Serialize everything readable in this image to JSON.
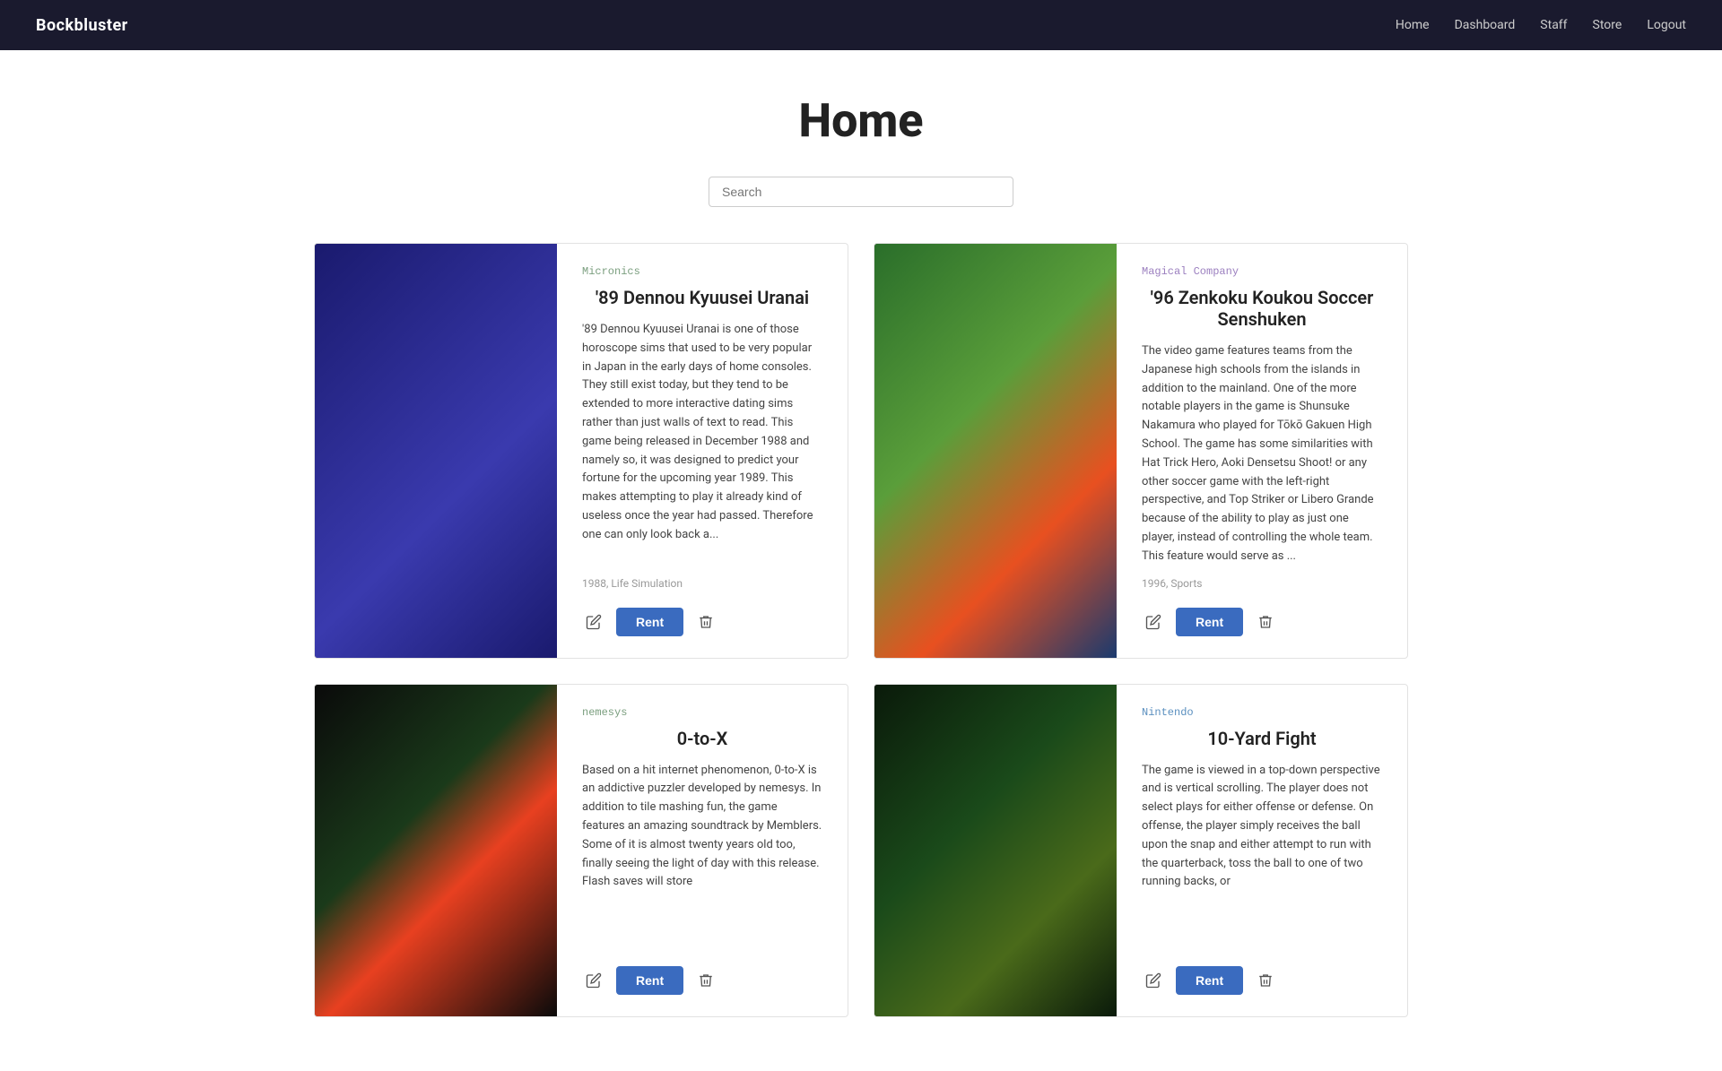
{
  "brand": "Bockbluster",
  "nav": {
    "links": [
      {
        "label": "Home",
        "id": "home"
      },
      {
        "label": "Dashboard",
        "id": "dashboard"
      },
      {
        "label": "Staff",
        "id": "staff"
      },
      {
        "label": "Store",
        "id": "store"
      },
      {
        "label": "Logout",
        "id": "logout"
      }
    ]
  },
  "page": {
    "title": "Home"
  },
  "search": {
    "placeholder": "Search"
  },
  "cards": [
    {
      "id": "card-89dennou",
      "publisher": "Micronics",
      "publisher_color": "green",
      "title": "'89 Dennou Kyuusei Uranai",
      "description": "'89 Dennou Kyuusei Uranai is one of those horoscope sims that used to be very popular in Japan in the early days of home consoles. They still exist today, but they tend to be extended to more interactive dating sims rather than just walls of text to read. This game being released in December 1988 and namely so, it was designed to predict your fortune for the upcoming year 1989. This makes attempting to play it already kind of useless once the year had passed. Therefore one can only look back a...",
      "meta": "1988, Life Simulation",
      "img_class": "img-89dennou",
      "rent_label": "Rent"
    },
    {
      "id": "card-96soccer",
      "publisher": "Magical Company",
      "publisher_color": "purple",
      "title": "'96 Zenkoku Koukou Soccer Senshuken",
      "description": "The video game features teams from the Japanese high schools from the islands in addition to the mainland. One of the more notable players in the game is Shunsuke Nakamura who played for Tōkō Gakuen High School. The game has some similarities with Hat Trick Hero, Aoki Densetsu Shoot! or any other soccer game with the left-right perspective, and Top Striker or Libero Grande because of the ability to play as just one player, instead of controlling the whole team. This feature would serve as ...",
      "meta": "1996, Sports",
      "img_class": "img-96soccer",
      "rent_label": "Rent"
    },
    {
      "id": "card-0tox",
      "publisher": "nemesys",
      "publisher_color": "green",
      "title": "0-to-X",
      "description": "Based on a hit internet phenomenon, 0-to-X is an addictive puzzler developed by nemesys. In addition to tile mashing fun, the game features an amazing soundtrack by Memblers. Some of it is almost twenty years old too, finally seeing the light of day with this release. Flash saves will store",
      "meta": "",
      "img_class": "img-0tox",
      "rent_label": "Rent"
    },
    {
      "id": "card-10yard",
      "publisher": "Nintendo",
      "publisher_color": "blue",
      "title": "10-Yard Fight",
      "description": "The game is viewed in a top-down perspective and is vertical scrolling. The player does not select plays for either offense or defense. On offense, the player simply receives the ball upon the snap and either attempt to run with the quarterback, toss the ball to one of two running backs, or",
      "meta": "",
      "img_class": "img-10yard",
      "rent_label": "Rent"
    }
  ],
  "icons": {
    "edit": "✎",
    "delete": "🗑",
    "rent": "Rent"
  }
}
